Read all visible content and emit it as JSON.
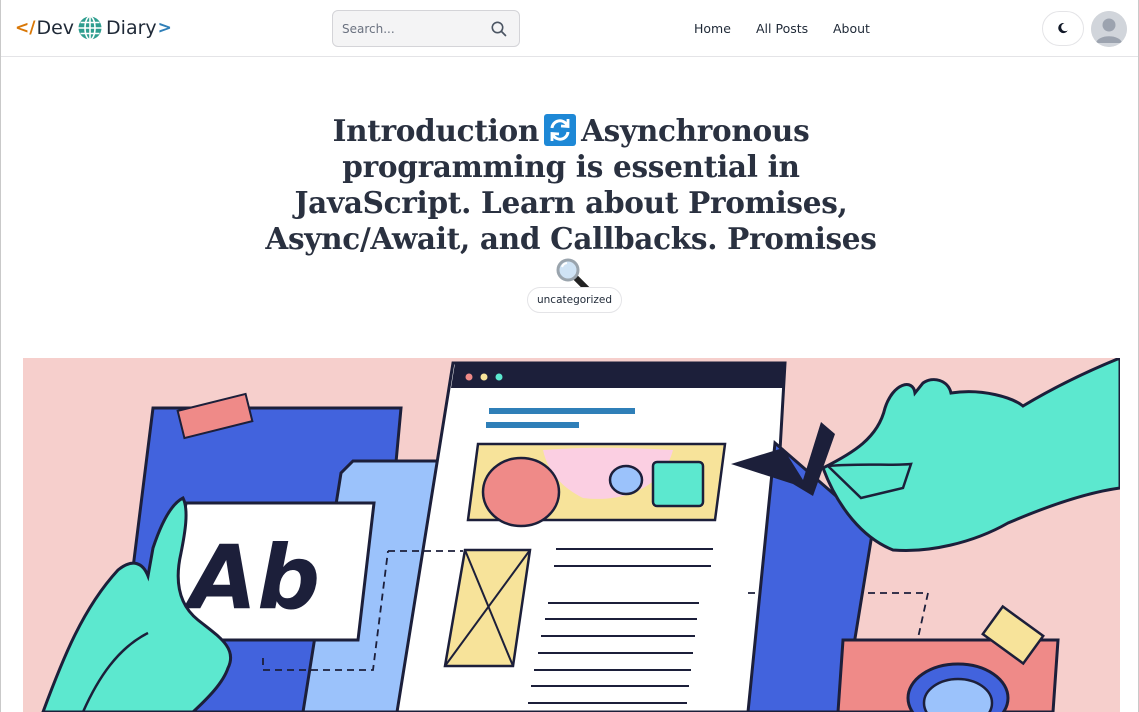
{
  "header": {
    "logo": {
      "prefix": "</",
      "word1": "Dev",
      "word2": "Diary",
      "suffix": ">",
      "icon": "globe-icon"
    },
    "search": {
      "placeholder": "Search...",
      "value": "",
      "icon": "search-icon"
    },
    "nav": [
      {
        "label": "Home"
      },
      {
        "label": "All Posts"
      },
      {
        "label": "About"
      }
    ],
    "theme_toggle_icon": "moon-icon",
    "avatar_icon": "user-avatar-icon"
  },
  "article": {
    "title_part1": "Introduction",
    "title_part2": "Asynchronous programming is essential in JavaScript. Learn about Promises, Async/Await, and Callbacks. Promises",
    "title_icons": [
      "sync-emoji-icon",
      "magnifier-emoji-icon"
    ],
    "category": "uncategorized",
    "hero_text": "Ab"
  },
  "colors": {
    "hero_bg": "#f6cfcc",
    "accent_green": "#5ce8cf",
    "accent_blue": "#4263dd",
    "logo_orange": "#d97706",
    "logo_blue": "#2f7fb8"
  }
}
